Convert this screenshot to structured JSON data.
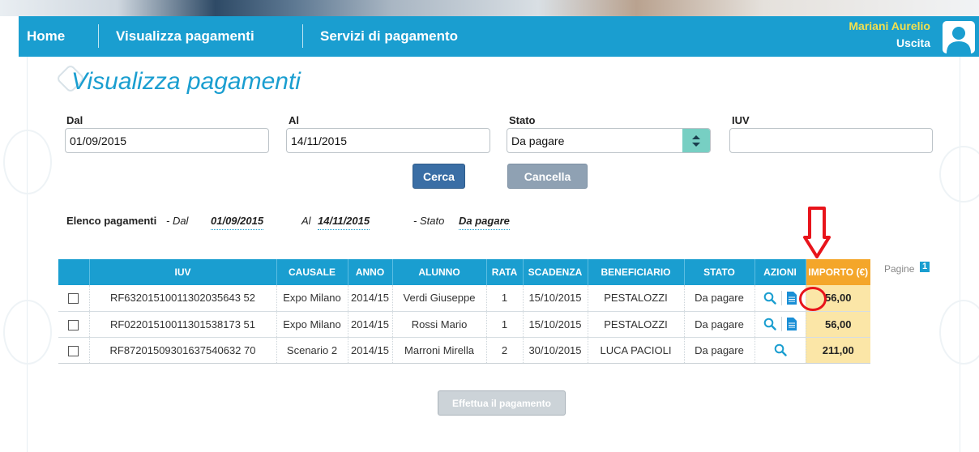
{
  "nav": {
    "home": "Home",
    "visualizza": "Visualizza pagamenti",
    "servizi": "Servizi di pagamento",
    "user_name": "Mariani Aurelio",
    "logout": "Uscita"
  },
  "page_title": "Visualizza pagamenti",
  "filters": {
    "dal_label": "Dal",
    "dal_value": "01/09/2015",
    "al_label": "Al",
    "al_value": "14/11/2015",
    "stato_label": "Stato",
    "stato_value": "Da pagare",
    "iuv_label": "IUV",
    "iuv_value": ""
  },
  "buttons": {
    "cerca": "Cerca",
    "cancella": "Cancella",
    "pay": "Effettua il pagamento"
  },
  "summary": {
    "title": "Elenco pagamenti",
    "dal_label": "- Dal",
    "dal_value": "01/09/2015",
    "al_label": "Al",
    "al_value": "14/11/2015",
    "stato_label": "- Stato",
    "stato_value": "Da pagare"
  },
  "pagination": {
    "label": "Pagine",
    "current": "1"
  },
  "table": {
    "headers": {
      "iuv": "IUV",
      "causale": "CAUSALE",
      "anno": "ANNO",
      "alunno": "ALUNNO",
      "rata": "RATA",
      "scadenza": "SCADENZA",
      "beneficiario": "BENEFICIARIO",
      "stato": "STATO",
      "azioni": "AZIONI",
      "importo": "IMPORTO (€)"
    },
    "rows": [
      {
        "iuv": "RF63201510011302035643 52",
        "causale": "Expo Milano",
        "anno": "2014/15",
        "alunno": "Verdi Giuseppe",
        "rata": "1",
        "scadenza": "15/10/2015",
        "beneficiario": "PESTALOZZI",
        "stato": "Da pagare",
        "importo": "56,00",
        "has_doc": true
      },
      {
        "iuv": "RF02201510011301538173 51",
        "causale": "Expo Milano",
        "anno": "2014/15",
        "alunno": "Rossi Mario",
        "rata": "1",
        "scadenza": "15/10/2015",
        "beneficiario": "PESTALOZZI",
        "stato": "Da pagare",
        "importo": "56,00",
        "has_doc": true
      },
      {
        "iuv": "RF87201509301637540632 70",
        "causale": "Scenario 2",
        "anno": "2014/15",
        "alunno": "Marroni Mirella",
        "rata": "2",
        "scadenza": "30/10/2015",
        "beneficiario": "LUCA PACIOLI",
        "stato": "Da pagare",
        "importo": "211,00",
        "has_doc": false
      }
    ]
  },
  "icons": {
    "arrow": "red-down-arrow-icon",
    "view": "magnifier-icon",
    "doc": "document-icon"
  },
  "colors": {
    "primary": "#1a9ed0",
    "accent_orange": "#f4a62a",
    "importo_bg": "#fbe6a7",
    "annotation_red": "#e8141b",
    "user_name": "#f4e04d"
  }
}
